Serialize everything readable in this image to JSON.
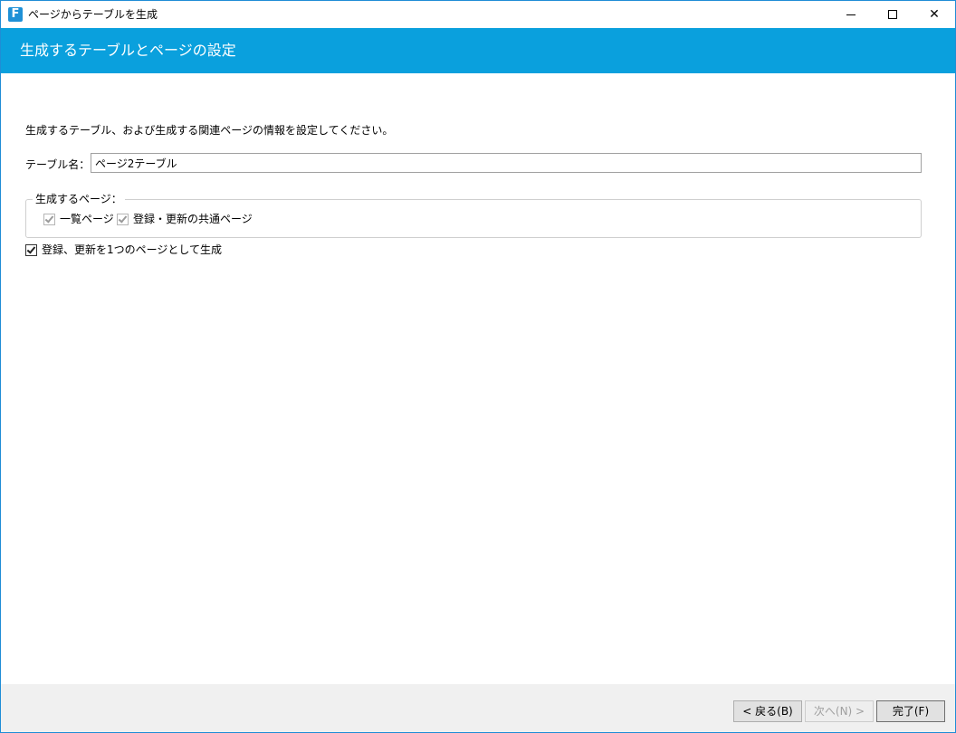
{
  "window": {
    "title": "ページからテーブルを生成",
    "app_icon_letter": "F"
  },
  "banner": {
    "title": "生成するテーブルとページの設定"
  },
  "form": {
    "description": "生成するテーブル、および生成する関連ページの情報を設定してください。",
    "table_name_label": "テーブル名：",
    "table_name_value": "ページ2テーブル",
    "pages_group_label": "生成するページ：",
    "list_page_label": "一覧ページ",
    "list_page_checked": true,
    "common_page_label": "登録・更新の共通ページ",
    "common_page_checked": true,
    "single_page_label": "登録、更新を1つのページとして生成",
    "single_page_checked": true
  },
  "footer": {
    "back_label": "< 戻る(B)",
    "next_label": "次へ(N) >",
    "finish_label": "完了(F)"
  }
}
